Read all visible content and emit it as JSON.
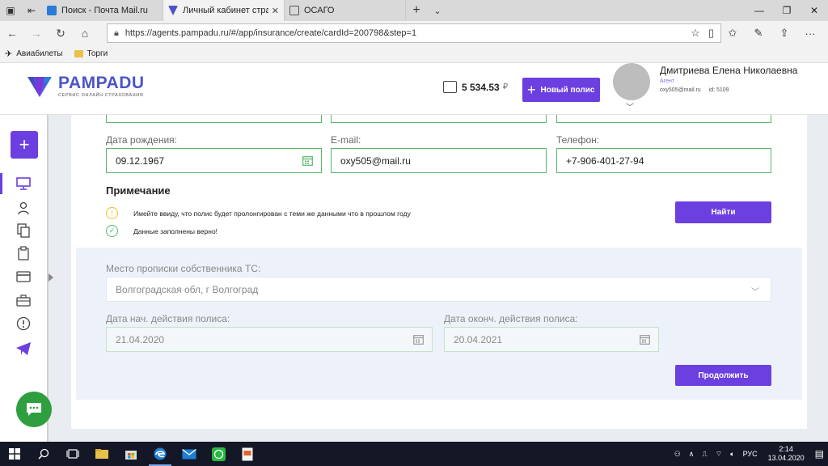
{
  "browser": {
    "tabs": [
      {
        "title": "Поиск - Почта Mail.ru",
        "active": false
      },
      {
        "title": "Личный кабинет страх",
        "active": true
      },
      {
        "title": "ОСАГО",
        "active": false
      }
    ],
    "url": "https://agents.pampadu.ru/#/app/insurance/create/cardId=200798&step=1",
    "favorites": [
      {
        "label": "Авиабилеты",
        "icon": "plane-icon"
      },
      {
        "label": "Торги",
        "icon": "folder-icon"
      }
    ]
  },
  "header": {
    "logo_text": "PAMPADU",
    "logo_subtitle": "СЕРВИС ОНЛАЙН СТРАХОВАНИЯ",
    "balance": "5 534.53",
    "currency": "₽",
    "new_policy_label": "Новый полис",
    "user": {
      "name": "Дмитриева Елена Николаевна",
      "role": "Агент",
      "email": "oxy505@mail.ru",
      "id": "id: 5109"
    }
  },
  "form": {
    "birth_date": {
      "label": "Дата рождения:",
      "value": "09.12.1967"
    },
    "email": {
      "label": "E-mail:",
      "value": "oxy505@mail.ru"
    },
    "phone": {
      "label": "Телефон:",
      "value": "+7-906-401-27-94"
    },
    "note_title": "Примечание",
    "notes": [
      {
        "text": "Имейте ввиду, что полис будет пролонгирован с теми же данными что в прошлом году",
        "type": "warning"
      },
      {
        "text": "Данные заполнены верно!",
        "type": "success"
      }
    ],
    "find_label": "Найти",
    "registration": {
      "label": "Место прописки собственника ТС:",
      "value": "Волгоградская обл, г Волгоград"
    },
    "start_date": {
      "label": "Дата нач. действия полиса:",
      "value": "21.04.2020"
    },
    "end_date": {
      "label": "Дата оконч. действия полиса:",
      "value": "20.04.2021"
    },
    "continue_label": "Продолжить"
  },
  "taskbar": {
    "lang": "РУС",
    "time": "2:14",
    "date": "13.04.2020"
  },
  "colors": {
    "accent": "#6c3fe0",
    "valid_border": "#56b86b",
    "warning": "#e8c21a",
    "success": "#56b86b"
  }
}
